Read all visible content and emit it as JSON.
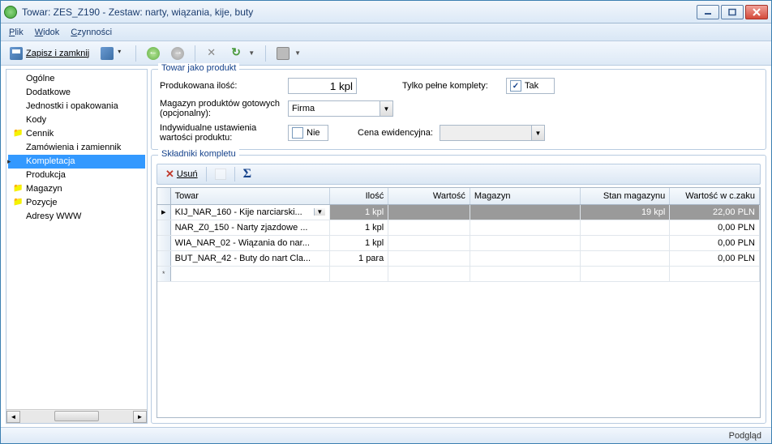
{
  "window": {
    "title": "Towar: ZES_Z190 - Zestaw: narty, wiązania, kije, buty"
  },
  "menu": {
    "file": "Plik",
    "view": "Widok",
    "actions": "Czynności"
  },
  "toolbar": {
    "save_close": "Zapisz i zamknij"
  },
  "sidebar": {
    "items": [
      {
        "label": "Ogólne",
        "folder": false
      },
      {
        "label": "Dodatkowe",
        "folder": false
      },
      {
        "label": "Jednostki i opakowania",
        "folder": false
      },
      {
        "label": "Kody",
        "folder": false
      },
      {
        "label": "Cennik",
        "folder": true
      },
      {
        "label": "Zamówienia i zamiennik",
        "folder": false
      },
      {
        "label": "Kompletacja",
        "folder": false,
        "selected": true
      },
      {
        "label": "Produkcja",
        "folder": false
      },
      {
        "label": "Magazyn",
        "folder": true
      },
      {
        "label": "Pozycje",
        "folder": true
      },
      {
        "label": "Adresy WWW",
        "folder": false
      }
    ]
  },
  "form": {
    "group1_title": "Towar jako produkt",
    "qty_label": "Produkowana ilość:",
    "qty_value": "1 kpl",
    "full_sets_label": "Tylko pełne komplety:",
    "full_sets_value": "Tak",
    "warehouse_label": "Magazyn produktów gotowych (opcjonalny):",
    "warehouse_value": "Firma",
    "individual_label": "Indywidualne ustawienia wartości produktu:",
    "individual_value": "Nie",
    "record_price_label": "Cena ewidencyjna:",
    "record_price_value": "",
    "group2_title": "Składniki kompletu",
    "delete_btn": "Usuń"
  },
  "grid": {
    "columns": {
      "towar": "Towar",
      "ilosc": "Ilość",
      "wartosc": "Wartość",
      "magazyn": "Magazyn",
      "stan": "Stan magazynu",
      "wcenie": "Wartość w c.zaku"
    },
    "rows": [
      {
        "towar": "KIJ_NAR_160 - Kije narciarski...",
        "ilosc": "1 kpl",
        "wartosc": "",
        "magazyn": "",
        "stan": "19 kpl",
        "wcenie": "22,00 PLN"
      },
      {
        "towar": "NAR_Z0_150 - Narty zjazdowe ...",
        "ilosc": "1 kpl",
        "wartosc": "",
        "magazyn": "",
        "stan": "",
        "wcenie": "0,00 PLN"
      },
      {
        "towar": "WIA_NAR_02 - Wiązania do nar...",
        "ilosc": "1 kpl",
        "wartosc": "",
        "magazyn": "",
        "stan": "",
        "wcenie": "0,00 PLN"
      },
      {
        "towar": "BUT_NAR_42 - Buty do nart Cla...",
        "ilosc": "1 para",
        "wartosc": "",
        "magazyn": "",
        "stan": "",
        "wcenie": "0,00 PLN"
      }
    ]
  },
  "status": {
    "text": "Podgląd"
  }
}
